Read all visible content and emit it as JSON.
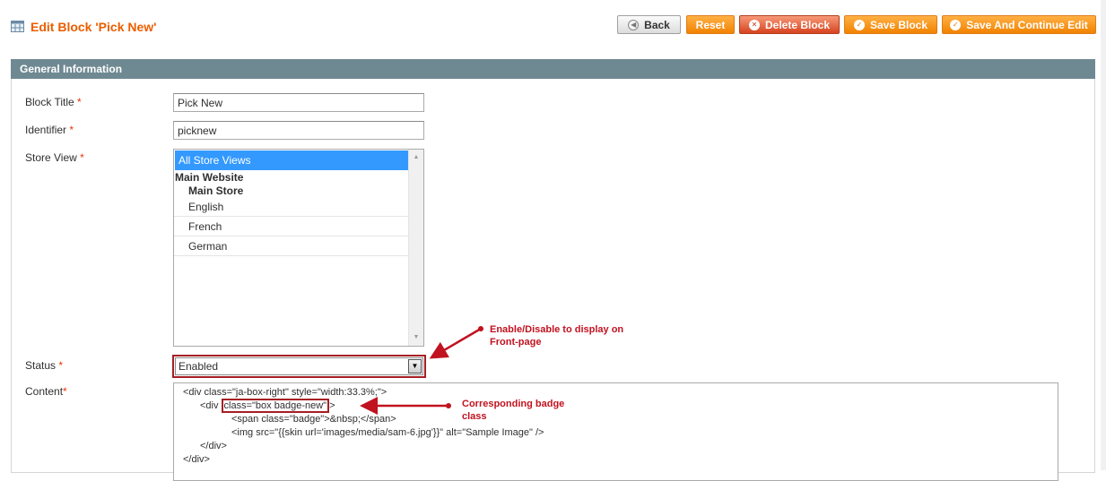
{
  "header": {
    "icon": "grid-page-icon",
    "title": "Edit Block 'Pick New'",
    "buttons": {
      "back": "Back",
      "reset": "Reset",
      "delete": "Delete Block",
      "save": "Save Block",
      "save_continue": "Save And Continue Edit"
    }
  },
  "section": {
    "title": "General Information"
  },
  "form": {
    "block_title": {
      "label": "Block Title",
      "value": "Pick New"
    },
    "identifier": {
      "label": "Identifier",
      "value": "picknew"
    },
    "store_view": {
      "label": "Store View",
      "options": [
        "All Store Views",
        "English",
        "French",
        "German"
      ],
      "selected": "All Store Views",
      "groups": {
        "website": "Main Website",
        "store": "Main Store"
      }
    },
    "status": {
      "label": "Status",
      "value": "Enabled"
    },
    "content": {
      "label": "Content",
      "lines": [
        "<div class=\"ja-box-right\" style=\"width:33.3%;\">",
        "<div ",
        "class=\"box badge-new\"",
        ">",
        "<span class=\"badge\">&nbsp;</span>",
        "<img src=\"{{skin url='images/media/sam-6.jpg'}}\" alt=\"Sample Image\" />",
        "</div>",
        "</div>"
      ]
    },
    "required_mark": "*"
  },
  "annotations": {
    "status_note_1": "Enable/Disable to display on",
    "status_note_2": "Front-page",
    "badge_note_1": "Corresponding badge",
    "badge_note_2": "class"
  },
  "colors": {
    "accent": "#eb5e00",
    "section_header": "#6f8992",
    "annotation": "#c1121f",
    "selected_option": "#3399ff"
  }
}
